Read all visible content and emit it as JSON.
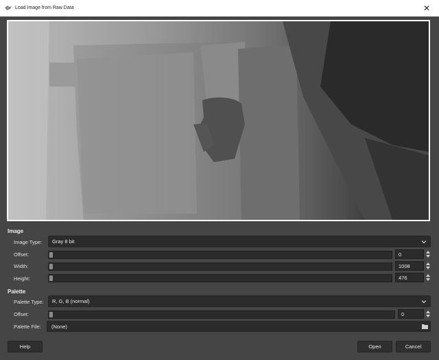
{
  "window": {
    "title": "Load Image from Raw Data",
    "close_glyph": "✕",
    "app_icon": "gimp-icon"
  },
  "image_section": {
    "title": "Image",
    "image_type": {
      "label": "Image Type:",
      "value": "Gray 8 bit"
    },
    "offset": {
      "label": "Offset:",
      "value": "0",
      "slider_fraction": 0
    },
    "width": {
      "label": "Width:",
      "value": "1008",
      "slider_fraction": 0
    },
    "height": {
      "label": "Height:",
      "value": "476",
      "slider_fraction": 0
    }
  },
  "palette_section": {
    "title": "Palette",
    "palette_type": {
      "label": "Palette Type:",
      "value": "R, G, B (normal)"
    },
    "offset": {
      "label": "Offset:",
      "value": "0",
      "slider_fraction": 0
    },
    "palette_file": {
      "label": "Palette File:",
      "value": "(None)"
    }
  },
  "buttons": {
    "help": "Help",
    "open": "Open",
    "cancel": "Cancel"
  },
  "colors": {
    "background": "#454545",
    "field": "#2b2b2b",
    "titlebar": "#ffffff"
  }
}
